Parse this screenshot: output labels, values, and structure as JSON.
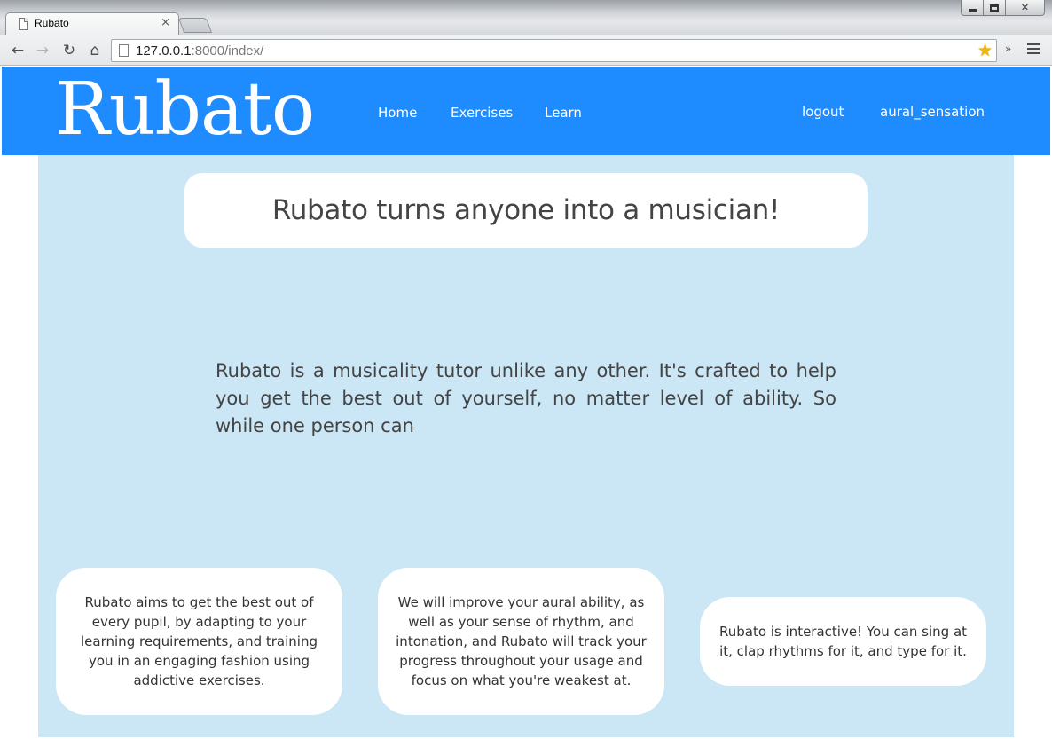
{
  "browser": {
    "tab_title": "Rubato",
    "url_host": "127.0.0.1",
    "url_rest": ":8000/index/"
  },
  "nav": {
    "brand": "Rubato",
    "links": [
      "Home",
      "Exercises",
      "Learn"
    ],
    "logout": "logout",
    "username": "aural_sensation"
  },
  "hero": {
    "title": "Rubato turns anyone into a musician!"
  },
  "intro": {
    "text": "Rubato is a musicality tutor unlike any other. It's crafted to help you get the best out of yourself, no matter level of ability. So while one person can"
  },
  "cards": [
    {
      "text": "Rubato aims to get the best out of every pupil, by adapting to your learning requirements, and training you in an engaging fashion using addictive exercises."
    },
    {
      "text": "We will improve your aural ability, as well as your sense of rhythm, and intonation, and Rubato will track your progress throughout your usage and focus on what you're weakest at."
    },
    {
      "text": "Rubato is interactive! You can sing at it, clap rhythms for it, and type for it."
    }
  ],
  "colors": {
    "header": "#1e8cff",
    "content_bg": "#cbe6f5",
    "card_bg": "#ffffff"
  }
}
